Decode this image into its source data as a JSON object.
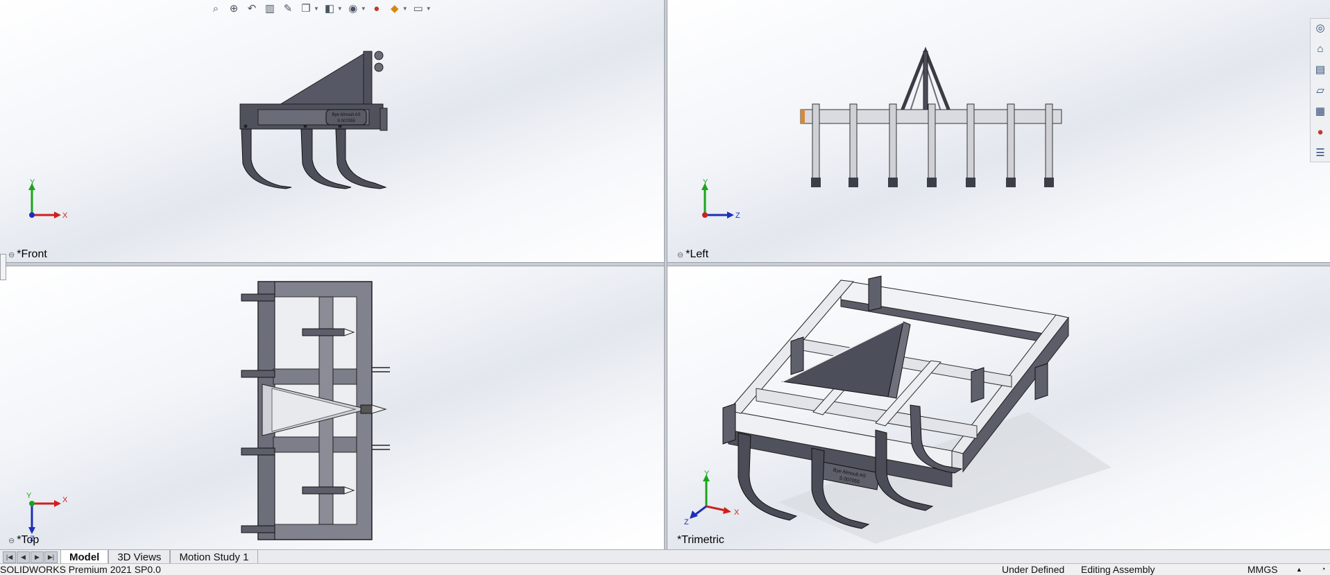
{
  "hud_toolbar": {
    "icons": [
      "zoom-to-fit-icon",
      "zoom-to-area-icon",
      "previous-view-icon",
      "section-view-icon",
      "dynamic-annotation-icon",
      "view-orientation-icon",
      "display-style-icon",
      "hide-show-items-icon",
      "edit-appearance-icon",
      "apply-scene-icon",
      "view-settings-icon"
    ]
  },
  "viewports": {
    "front": {
      "label": "*Front",
      "axis1": "Y",
      "axis2": "X"
    },
    "left": {
      "label": "*Left",
      "axis1": "Y",
      "axis2": "Z"
    },
    "top": {
      "label": "*Top",
      "axis1": "X",
      "axis2": "Z",
      "axis3": "Y"
    },
    "trimetric": {
      "label": "*Trimetric",
      "axis1": "Y",
      "axis2": "X",
      "axis3": "Z"
    }
  },
  "plate_text": {
    "line1": "Bye Almoult AS",
    "line2": "S 007055"
  },
  "task_pane": {
    "icons": [
      "solidworks-resources-icon",
      "home-icon",
      "design-library-icon",
      "file-explorer-icon",
      "view-palette-icon",
      "appearances-icon",
      "custom-properties-icon"
    ]
  },
  "tabs": [
    {
      "label": "Model",
      "active": true
    },
    {
      "label": "3D Views",
      "active": false
    },
    {
      "label": "Motion Study 1",
      "active": false
    }
  ],
  "nav_buttons": [
    "|◀",
    "◀",
    "▶",
    "▶|"
  ],
  "status": {
    "product": "SOLIDWORKS Premium 2021 SP0.0",
    "definition": "Under Defined",
    "mode": "Editing Assembly",
    "units": "MMGS"
  },
  "colors": {
    "x_axis": "#d0201c",
    "y_axis": "#1aa51a",
    "z_axis": "#1b2fb8",
    "metal": "#5d5f6a",
    "metal_light": "#9a9ca6"
  }
}
